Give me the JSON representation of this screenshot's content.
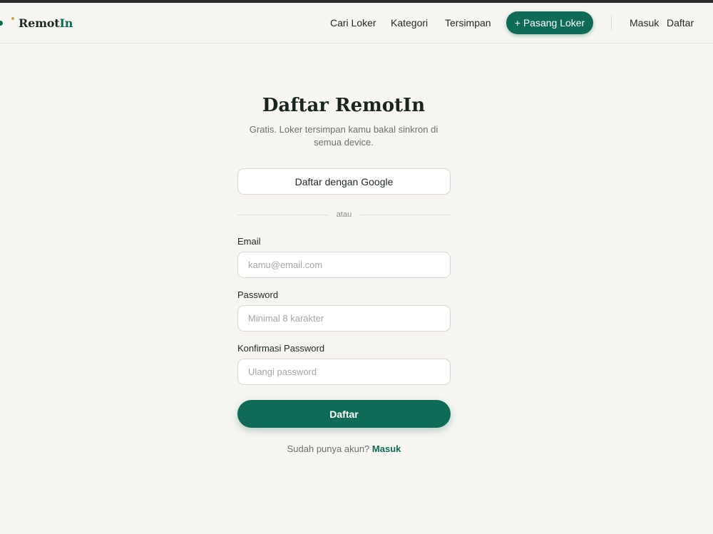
{
  "colors": {
    "brand": "#0f6b57",
    "accent_gold": "#d9a23f",
    "background": "#f6f5f1"
  },
  "brand": {
    "name_part1": "Remot",
    "name_part2": "In"
  },
  "nav": {
    "links": [
      "Cari Loker",
      "Kategori",
      "Tersimpan"
    ],
    "post_job_label": "+ Pasang Loker",
    "login_label": "Masuk",
    "register_label": "Daftar"
  },
  "signup": {
    "title": "Daftar RemotIn",
    "subtitle": "Gratis. Loker tersimpan kamu bakal sinkron di semua device.",
    "google_button": "Daftar dengan Google",
    "divider_text": "atau",
    "email": {
      "label": "Email",
      "placeholder": "kamu@email.com",
      "value": ""
    },
    "password": {
      "label": "Password",
      "placeholder": "Minimal 8 karakter",
      "value": ""
    },
    "confirm_password": {
      "label": "Konfirmasi Password",
      "placeholder": "Ulangi password",
      "value": ""
    },
    "submit_label": "Daftar",
    "have_account_text": "Sudah punya akun?",
    "login_link": "Masuk"
  }
}
